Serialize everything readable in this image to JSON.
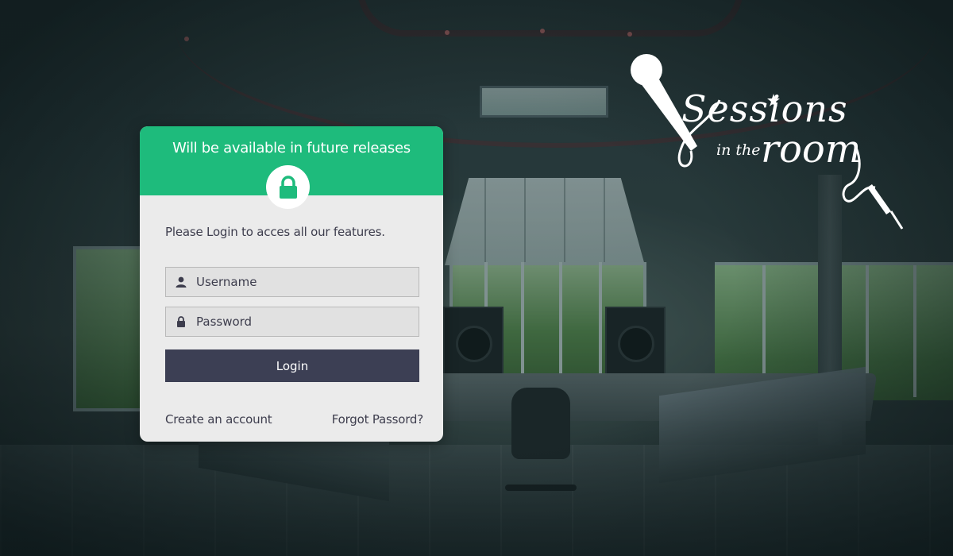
{
  "login_card": {
    "header_title": "Will be available in future releases",
    "lock_icon": "lock-icon",
    "intro_text": "Please Login to acces all our features.",
    "username": {
      "placeholder": "Username",
      "value": "",
      "icon": "user-icon"
    },
    "password": {
      "placeholder": "Password",
      "value": "",
      "icon": "lock-icon"
    },
    "login_label": "Login",
    "create_account_label": "Create an account",
    "forgot_password_label": "Forgot Passord?"
  },
  "logo": {
    "main": "Sessions",
    "small": "in the",
    "room": "room",
    "icon": "microphone-icon"
  },
  "colors": {
    "header_green": "#1ebb7c",
    "button_dark": "#3c3f54",
    "card_bg": "#ebebeb",
    "text": "#3d3d4d"
  }
}
